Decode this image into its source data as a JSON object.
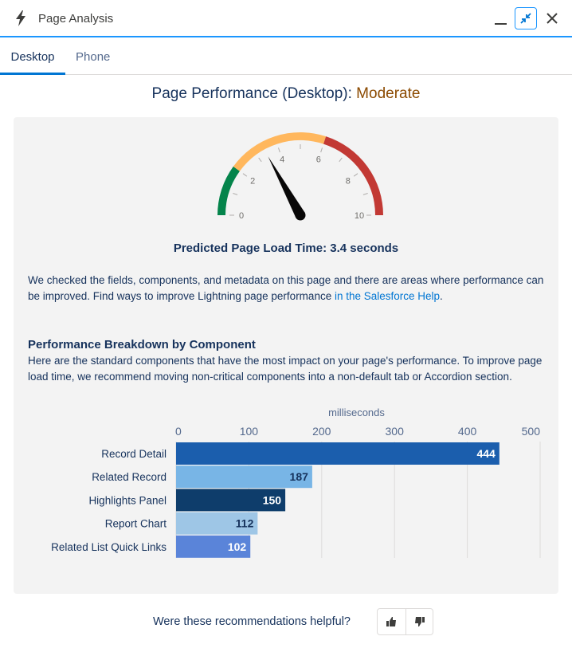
{
  "window": {
    "title": "Page Analysis"
  },
  "tabs": [
    {
      "label": "Desktop"
    },
    {
      "label": "Phone"
    }
  ],
  "performance": {
    "title_prefix": "Page Performance (Desktop):",
    "rating": "Moderate"
  },
  "gauge": {
    "value": 3.4,
    "min": 0,
    "max": 10,
    "tick_labels": [
      "0",
      "2",
      "4",
      "6",
      "8",
      "10"
    ],
    "zones": [
      {
        "from": 0,
        "to": 2,
        "color": "#04844b"
      },
      {
        "from": 2,
        "to": 6,
        "color": "#ffb75d"
      },
      {
        "from": 6,
        "to": 10,
        "color": "#c23934"
      }
    ]
  },
  "load_time": {
    "text": "Predicted Page Load Time: 3.4 seconds"
  },
  "description": {
    "text": "We checked the fields, components, and metadata on this page and there are areas where performance can be improved. Find ways to improve Lightning page performance ",
    "link": "in the Salesforce Help",
    "end": "."
  },
  "breakdown": {
    "title": "Performance Breakdown by Component",
    "description": "Here are the standard components that have the most impact on your page's performance. To improve page load time, we recommend moving non-critical components into a non-default tab or Accordion section."
  },
  "chart_data": {
    "type": "bar",
    "orientation": "horizontal",
    "xlabel": "milliseconds",
    "xlim": [
      0,
      500
    ],
    "xticks": [
      "0",
      "100",
      "200",
      "300",
      "400",
      "500"
    ],
    "categories": [
      "Record Detail",
      "Related Record",
      "Highlights Panel",
      "Report Chart",
      "Related List Quick Links"
    ],
    "values": [
      444,
      187,
      150,
      112,
      102
    ],
    "colors": [
      "#1b5ead",
      "#78b5e6",
      "#0e3d6b",
      "#9ec6e6",
      "#5a84d9"
    ],
    "label_colors": [
      "#ffffff",
      "#16325c",
      "#ffffff",
      "#16325c",
      "#ffffff"
    ],
    "grid": true
  },
  "feedback": {
    "question": "Were these recommendations helpful?"
  }
}
